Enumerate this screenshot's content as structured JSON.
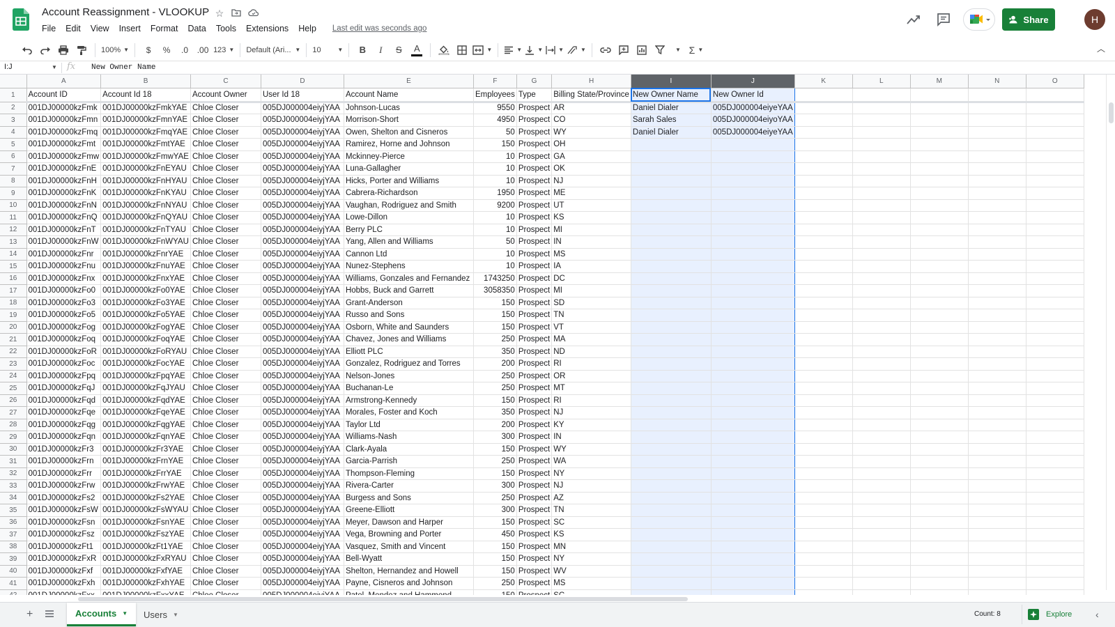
{
  "header": {
    "title": "Account Reassignment - VLOOKUP",
    "menu": [
      "File",
      "Edit",
      "View",
      "Insert",
      "Format",
      "Data",
      "Tools",
      "Extensions",
      "Help"
    ],
    "last_edit": "Last edit was seconds ago",
    "share_label": "Share",
    "avatar_initial": "H"
  },
  "toolbar": {
    "zoom": "100%",
    "currency": "$",
    "percent": "%",
    "dec_decrease": ".0",
    "dec_increase": ".00",
    "number_format": "123",
    "font": "Default (Ari...",
    "font_size": "10",
    "bold": "B",
    "italic": "I",
    "strike": "S",
    "text_color": "A",
    "sigma": "Σ"
  },
  "formula_bar": {
    "name_box": "I:J",
    "fx": "fx",
    "formula": "New Owner Name"
  },
  "grid": {
    "columns": [
      "A",
      "B",
      "C",
      "D",
      "E",
      "F",
      "G",
      "H",
      "I",
      "J",
      "K",
      "L",
      "M",
      "N",
      "O"
    ],
    "selected_columns": [
      "I",
      "J"
    ],
    "header_row": [
      "Account ID",
      "Account Id 18",
      "Account Owner",
      "User Id 18",
      "Account Name",
      "Employees",
      "Type",
      "Billing State/Province",
      "New Owner Name",
      "New Owner Id"
    ],
    "rows": [
      [
        "001DJ00000kzFmk",
        "001DJ00000kzFmkYAE",
        "Chloe Closer",
        "005DJ000004eiyjYAA",
        "Johnson-Lucas",
        "9550",
        "Prospect",
        "AR",
        "Daniel Dialer",
        "005DJ000004eiyeYAA"
      ],
      [
        "001DJ00000kzFmn",
        "001DJ00000kzFmnYAE",
        "Chloe Closer",
        "005DJ000004eiyjYAA",
        "Morrison-Short",
        "4950",
        "Prospect",
        "CO",
        "Sarah Sales",
        "005DJ000004eiyoYAA"
      ],
      [
        "001DJ00000kzFmq",
        "001DJ00000kzFmqYAE",
        "Chloe Closer",
        "005DJ000004eiyjYAA",
        "Owen, Shelton and Cisneros",
        "50",
        "Prospect",
        "WY",
        "Daniel Dialer",
        "005DJ000004eiyeYAA"
      ],
      [
        "001DJ00000kzFmt",
        "001DJ00000kzFmtYAE",
        "Chloe Closer",
        "005DJ000004eiyjYAA",
        "Ramirez, Horne and Johnson",
        "150",
        "Prospect",
        "OH",
        "",
        ""
      ],
      [
        "001DJ00000kzFmw",
        "001DJ00000kzFmwYAE",
        "Chloe Closer",
        "005DJ000004eiyjYAA",
        "Mckinney-Pierce",
        "10",
        "Prospect",
        "GA",
        "",
        ""
      ],
      [
        "001DJ00000kzFnE",
        "001DJ00000kzFnEYAU",
        "Chloe Closer",
        "005DJ000004eiyjYAA",
        "Luna-Gallagher",
        "10",
        "Prospect",
        "OK",
        "",
        ""
      ],
      [
        "001DJ00000kzFnH",
        "001DJ00000kzFnHYAU",
        "Chloe Closer",
        "005DJ000004eiyjYAA",
        "Hicks, Porter and Williams",
        "10",
        "Prospect",
        "NJ",
        "",
        ""
      ],
      [
        "001DJ00000kzFnK",
        "001DJ00000kzFnKYAU",
        "Chloe Closer",
        "005DJ000004eiyjYAA",
        "Cabrera-Richardson",
        "1950",
        "Prospect",
        "ME",
        "",
        ""
      ],
      [
        "001DJ00000kzFnN",
        "001DJ00000kzFnNYAU",
        "Chloe Closer",
        "005DJ000004eiyjYAA",
        "Vaughan, Rodriguez and Smith",
        "9200",
        "Prospect",
        "UT",
        "",
        ""
      ],
      [
        "001DJ00000kzFnQ",
        "001DJ00000kzFnQYAU",
        "Chloe Closer",
        "005DJ000004eiyjYAA",
        "Lowe-Dillon",
        "10",
        "Prospect",
        "KS",
        "",
        ""
      ],
      [
        "001DJ00000kzFnT",
        "001DJ00000kzFnTYAU",
        "Chloe Closer",
        "005DJ000004eiyjYAA",
        "Berry PLC",
        "10",
        "Prospect",
        "MI",
        "",
        ""
      ],
      [
        "001DJ00000kzFnW",
        "001DJ00000kzFnWYAU",
        "Chloe Closer",
        "005DJ000004eiyjYAA",
        "Yang, Allen and Williams",
        "50",
        "Prospect",
        "IN",
        "",
        ""
      ],
      [
        "001DJ00000kzFnr",
        "001DJ00000kzFnrYAE",
        "Chloe Closer",
        "005DJ000004eiyjYAA",
        "Cannon Ltd",
        "10",
        "Prospect",
        "MS",
        "",
        ""
      ],
      [
        "001DJ00000kzFnu",
        "001DJ00000kzFnuYAE",
        "Chloe Closer",
        "005DJ000004eiyjYAA",
        "Nunez-Stephens",
        "10",
        "Prospect",
        "IA",
        "",
        ""
      ],
      [
        "001DJ00000kzFnx",
        "001DJ00000kzFnxYAE",
        "Chloe Closer",
        "005DJ000004eiyjYAA",
        "Williams, Gonzales and Fernandez",
        "1743250",
        "Prospect",
        "DC",
        "",
        ""
      ],
      [
        "001DJ00000kzFo0",
        "001DJ00000kzFo0YAE",
        "Chloe Closer",
        "005DJ000004eiyjYAA",
        "Hobbs, Buck and Garrett",
        "3058350",
        "Prospect",
        "MI",
        "",
        ""
      ],
      [
        "001DJ00000kzFo3",
        "001DJ00000kzFo3YAE",
        "Chloe Closer",
        "005DJ000004eiyjYAA",
        "Grant-Anderson",
        "150",
        "Prospect",
        "SD",
        "",
        ""
      ],
      [
        "001DJ00000kzFo5",
        "001DJ00000kzFo5YAE",
        "Chloe Closer",
        "005DJ000004eiyjYAA",
        "Russo and Sons",
        "150",
        "Prospect",
        "TN",
        "",
        ""
      ],
      [
        "001DJ00000kzFog",
        "001DJ00000kzFogYAE",
        "Chloe Closer",
        "005DJ000004eiyjYAA",
        "Osborn, White and Saunders",
        "150",
        "Prospect",
        "VT",
        "",
        ""
      ],
      [
        "001DJ00000kzFoq",
        "001DJ00000kzFoqYAE",
        "Chloe Closer",
        "005DJ000004eiyjYAA",
        "Chavez, Jones and Williams",
        "250",
        "Prospect",
        "MA",
        "",
        ""
      ],
      [
        "001DJ00000kzFoR",
        "001DJ00000kzFoRYAU",
        "Chloe Closer",
        "005DJ000004eiyjYAA",
        "Elliott PLC",
        "350",
        "Prospect",
        "ND",
        "",
        ""
      ],
      [
        "001DJ00000kzFoc",
        "001DJ00000kzFocYAE",
        "Chloe Closer",
        "005DJ000004eiyjYAA",
        "Gonzalez, Rodriguez and Torres",
        "200",
        "Prospect",
        "RI",
        "",
        ""
      ],
      [
        "001DJ00000kzFpq",
        "001DJ00000kzFpqYAE",
        "Chloe Closer",
        "005DJ000004eiyjYAA",
        "Nelson-Jones",
        "250",
        "Prospect",
        "OR",
        "",
        ""
      ],
      [
        "001DJ00000kzFqJ",
        "001DJ00000kzFqJYAU",
        "Chloe Closer",
        "005DJ000004eiyjYAA",
        "Buchanan-Le",
        "250",
        "Prospect",
        "MT",
        "",
        ""
      ],
      [
        "001DJ00000kzFqd",
        "001DJ00000kzFqdYAE",
        "Chloe Closer",
        "005DJ000004eiyjYAA",
        "Armstrong-Kennedy",
        "150",
        "Prospect",
        "RI",
        "",
        ""
      ],
      [
        "001DJ00000kzFqe",
        "001DJ00000kzFqeYAE",
        "Chloe Closer",
        "005DJ000004eiyjYAA",
        "Morales, Foster and Koch",
        "350",
        "Prospect",
        "NJ",
        "",
        ""
      ],
      [
        "001DJ00000kzFqg",
        "001DJ00000kzFqgYAE",
        "Chloe Closer",
        "005DJ000004eiyjYAA",
        "Taylor Ltd",
        "200",
        "Prospect",
        "KY",
        "",
        ""
      ],
      [
        "001DJ00000kzFqn",
        "001DJ00000kzFqnYAE",
        "Chloe Closer",
        "005DJ000004eiyjYAA",
        "Williams-Nash",
        "300",
        "Prospect",
        "IN",
        "",
        ""
      ],
      [
        "001DJ00000kzFr3",
        "001DJ00000kzFr3YAE",
        "Chloe Closer",
        "005DJ000004eiyjYAA",
        "Clark-Ayala",
        "150",
        "Prospect",
        "WY",
        "",
        ""
      ],
      [
        "001DJ00000kzFrn",
        "001DJ00000kzFrnYAE",
        "Chloe Closer",
        "005DJ000004eiyjYAA",
        "Garcia-Parrish",
        "250",
        "Prospect",
        "WA",
        "",
        ""
      ],
      [
        "001DJ00000kzFrr",
        "001DJ00000kzFrrYAE",
        "Chloe Closer",
        "005DJ000004eiyjYAA",
        "Thompson-Fleming",
        "150",
        "Prospect",
        "NY",
        "",
        ""
      ],
      [
        "001DJ00000kzFrw",
        "001DJ00000kzFrwYAE",
        "Chloe Closer",
        "005DJ000004eiyjYAA",
        "Rivera-Carter",
        "300",
        "Prospect",
        "NJ",
        "",
        ""
      ],
      [
        "001DJ00000kzFs2",
        "001DJ00000kzFs2YAE",
        "Chloe Closer",
        "005DJ000004eiyjYAA",
        "Burgess and Sons",
        "250",
        "Prospect",
        "AZ",
        "",
        ""
      ],
      [
        "001DJ00000kzFsW",
        "001DJ00000kzFsWYAU",
        "Chloe Closer",
        "005DJ000004eiyjYAA",
        "Greene-Elliott",
        "300",
        "Prospect",
        "TN",
        "",
        ""
      ],
      [
        "001DJ00000kzFsn",
        "001DJ00000kzFsnYAE",
        "Chloe Closer",
        "005DJ000004eiyjYAA",
        "Meyer, Dawson and Harper",
        "150",
        "Prospect",
        "SC",
        "",
        ""
      ],
      [
        "001DJ00000kzFsz",
        "001DJ00000kzFszYAE",
        "Chloe Closer",
        "005DJ000004eiyjYAA",
        "Vega, Browning and Porter",
        "450",
        "Prospect",
        "KS",
        "",
        ""
      ],
      [
        "001DJ00000kzFt1",
        "001DJ00000kzFt1YAE",
        "Chloe Closer",
        "005DJ000004eiyjYAA",
        "Vasquez, Smith and Vincent",
        "150",
        "Prospect",
        "MN",
        "",
        ""
      ],
      [
        "001DJ00000kzFxR",
        "001DJ00000kzFxRYAU",
        "Chloe Closer",
        "005DJ000004eiyjYAA",
        "Bell-Wyatt",
        "150",
        "Prospect",
        "NY",
        "",
        ""
      ],
      [
        "001DJ00000kzFxf",
        "001DJ00000kzFxfYAE",
        "Chloe Closer",
        "005DJ000004eiyjYAA",
        "Shelton, Hernandez and Howell",
        "150",
        "Prospect",
        "WV",
        "",
        ""
      ],
      [
        "001DJ00000kzFxh",
        "001DJ00000kzFxhYAE",
        "Chloe Closer",
        "005DJ000004eiyjYAA",
        "Payne, Cisneros and Johnson",
        "250",
        "Prospect",
        "MS",
        "",
        ""
      ],
      [
        "001DJ00000kzFxx",
        "001DJ00000kzFxxYAE",
        "Chloe Closer",
        "005DJ000004eiyjYAA",
        "Patel, Mendez and Hammond",
        "150",
        "Prospect",
        "SC",
        "",
        ""
      ]
    ]
  },
  "bottom": {
    "sheets": [
      {
        "name": "Accounts",
        "active": true
      },
      {
        "name": "Users",
        "active": false
      }
    ],
    "count": "Count: 8",
    "explore": "Explore"
  },
  "colors": {
    "brand_green": "#188038",
    "selection_blue": "#1a73e8",
    "selection_fill": "#e8f0fe"
  }
}
